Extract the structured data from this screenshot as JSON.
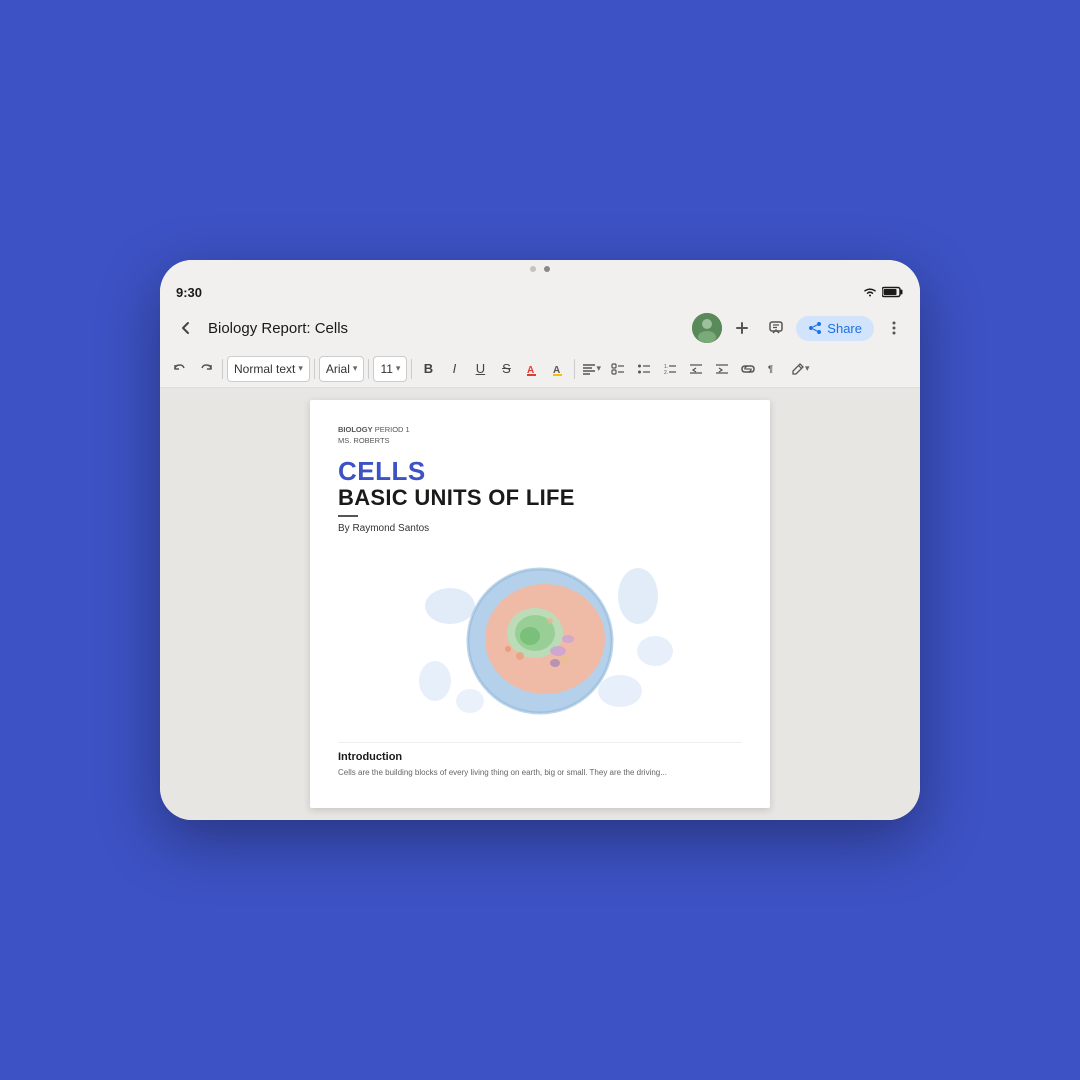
{
  "background_color": "#3d52c4",
  "tablet": {
    "status_bar": {
      "time": "9:30"
    },
    "app_bar": {
      "title": "Biology Report: Cells",
      "share_label": "Share"
    },
    "toolbar": {
      "undo": "↩",
      "redo": "↪",
      "paragraph_style": "Normal text",
      "font": "Arial",
      "font_size": "11",
      "bold": "B",
      "italic": "I",
      "underline": "U",
      "strikethrough": "S",
      "text_color": "A",
      "highlight": "A",
      "align": "≡",
      "more_options": "⋯"
    },
    "document": {
      "header_bold": "BIOLOGY",
      "header_period": " PERIOD 1",
      "header_teacher": "MS. ROBERTS",
      "title": "CELLS",
      "subtitle": "BASIC UNITS OF LIFE",
      "author": "By Raymond Santos",
      "intro_heading": "Introduction",
      "intro_text": "Cells are the building blocks of every living thing on earth, big or small. They are the driving..."
    }
  }
}
